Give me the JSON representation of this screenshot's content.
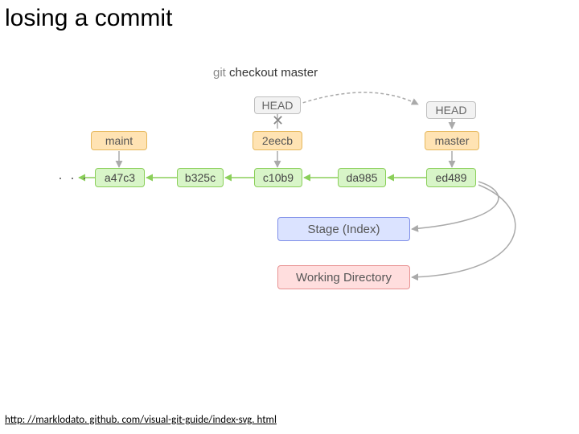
{
  "title": "losing a commit",
  "command": {
    "git": "git",
    "args": "checkout master"
  },
  "heads": {
    "old": "HEAD",
    "new": "HEAD"
  },
  "xmark": "✕",
  "branches": {
    "maint": "maint",
    "lost": "2eecb",
    "master": "master"
  },
  "commits": {
    "a47c3": "a47c3",
    "b325c": "b325c",
    "c10b9": "c10b9",
    "da985": "da985",
    "ed489": "ed489"
  },
  "stage": "Stage (Index)",
  "workdir": "Working Directory",
  "dots": "· · ·",
  "footer": "http: //marklodato. github. com/visual-git-guide/index-svg. html",
  "colors": {
    "head": "#f2f2f2",
    "branch": "#ffe3b3",
    "commit": "#d8f5c8",
    "stage": "#dbe3ff",
    "work": "#ffdede",
    "arrow_gray": "#aaaaaa",
    "arrow_green": "#8bcf5a"
  }
}
